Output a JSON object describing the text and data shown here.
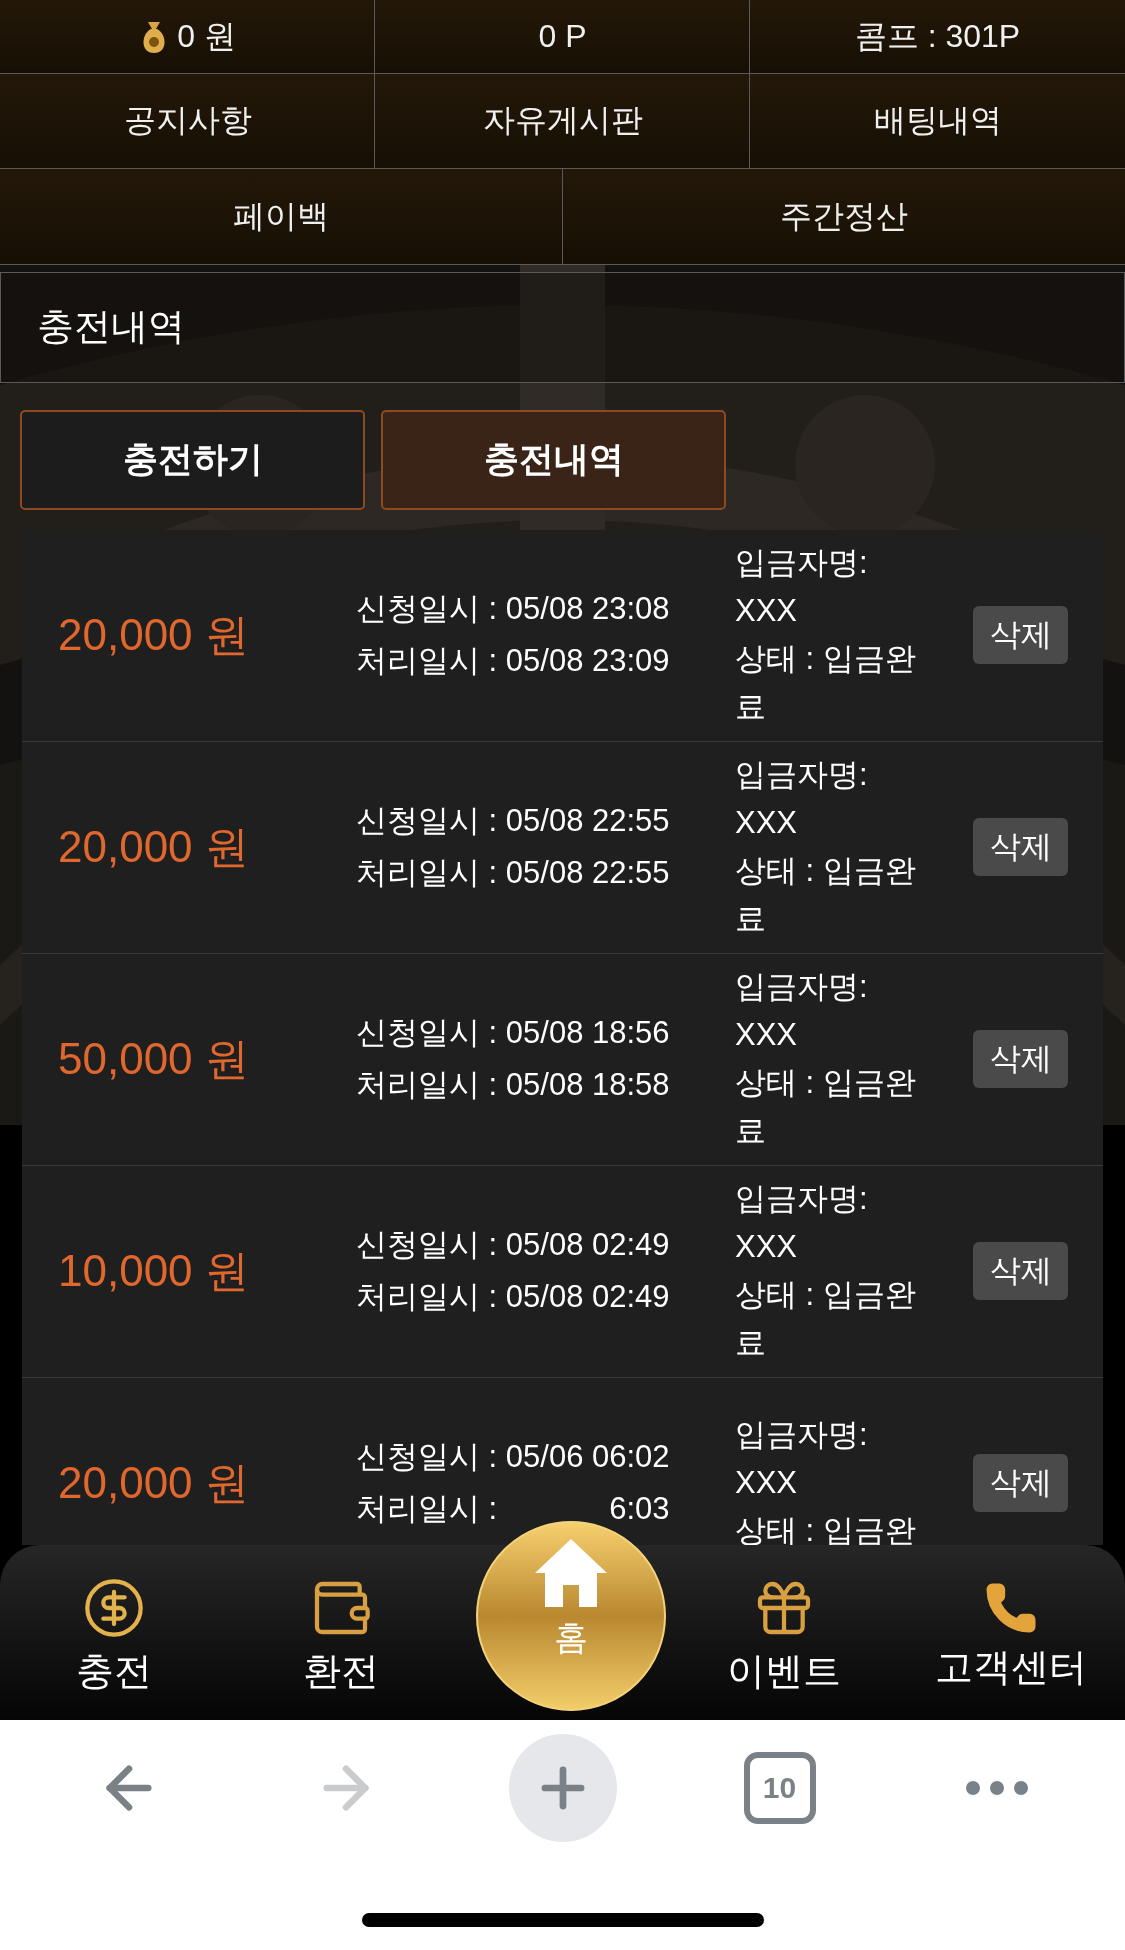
{
  "header": [
    {
      "label": "0 원",
      "kind": "money"
    },
    {
      "label": "0 P",
      "kind": "plain"
    },
    {
      "label": "콤프 : 301P",
      "kind": "plain"
    }
  ],
  "menu": [
    "공지사항",
    "자유게시판",
    "배팅내역",
    "페이백",
    "주간정산"
  ],
  "section_title": "충전내역",
  "tabs": [
    {
      "label": "충전하기",
      "selected": false
    },
    {
      "label": "충전내역",
      "selected": true
    }
  ],
  "records": [
    {
      "amount": "20,000 원",
      "requested": "신청일시 : 05/08 23:08",
      "processed": "처리일시 : 05/08 23:09",
      "depositor": "입금자명: XXX",
      "status": "상태 : 입금완료",
      "action": "삭제"
    },
    {
      "amount": "20,000 원",
      "requested": "신청일시 : 05/08 22:55",
      "processed": "처리일시 : 05/08 22:55",
      "depositor": "입금자명: XXX",
      "status": "상태 : 입금완료",
      "action": "삭제"
    },
    {
      "amount": "50,000 원",
      "requested": "신청일시 : 05/08 18:56",
      "processed": "처리일시 : 05/08 18:58",
      "depositor": "입금자명: XXX",
      "status": "상태 : 입금완료",
      "action": "삭제"
    },
    {
      "amount": "10,000 원",
      "requested": "신청일시 : 05/08 02:49",
      "processed": "처리일시 : 05/08 02:49",
      "depositor": "입금자명: XXX",
      "status": "상태 : 입금완료",
      "action": "삭제"
    },
    {
      "amount": "20,000 원",
      "requested": "신청일시 : 05/06 06:02",
      "processed_parts": [
        "처리일시 :",
        "6:03"
      ],
      "depositor": "입금자명: XXX",
      "status": "상태 : 입금완",
      "action": "삭제"
    }
  ],
  "bottom_nav": [
    {
      "label": "충전",
      "kind": "coin"
    },
    {
      "label": "환전",
      "kind": "wallet"
    },
    {
      "label": "홈",
      "kind": "home"
    },
    {
      "label": "이벤트",
      "kind": "gift"
    },
    {
      "label": "고객센터",
      "kind": "phone"
    }
  ],
  "browser_bar": [
    {
      "kind": "back",
      "disabled": false
    },
    {
      "kind": "forward",
      "disabled": true
    },
    {
      "kind": "new_tab",
      "disabled": false
    },
    {
      "kind": "tabs",
      "label": "10",
      "disabled": false
    },
    {
      "kind": "more",
      "disabled": false
    }
  ]
}
